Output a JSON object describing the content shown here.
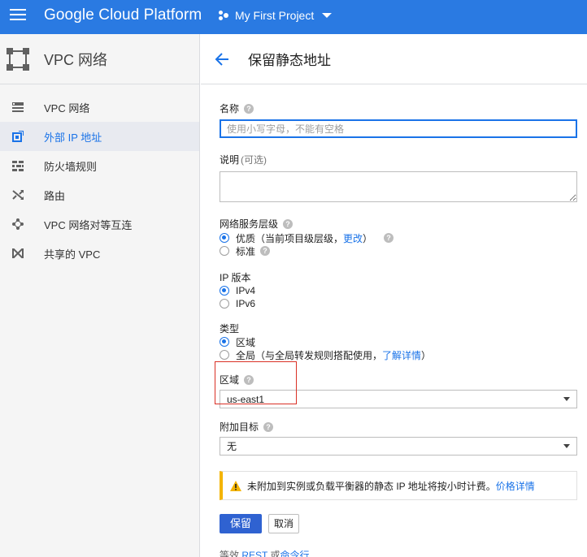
{
  "topbar": {
    "brand": "Google Cloud Platform",
    "project": "My First Project",
    "color": "#2a7ae2"
  },
  "sidebar": {
    "title": "VPC 网络",
    "items": [
      {
        "label": "VPC 网络",
        "icon": "vpc-network-icon",
        "active": false
      },
      {
        "label": "外部 IP 地址",
        "icon": "external-ip-icon",
        "active": true
      },
      {
        "label": "防火墙规则",
        "icon": "firewall-icon",
        "active": false
      },
      {
        "label": "路由",
        "icon": "routes-icon",
        "active": false
      },
      {
        "label": "VPC 网络对等互连",
        "icon": "peering-icon",
        "active": false
      },
      {
        "label": "共享的 VPC",
        "icon": "shared-vpc-icon",
        "active": false
      }
    ]
  },
  "main": {
    "title": "保留静态地址",
    "name_label": "名称",
    "name_placeholder": "使用小写字母，不能有空格",
    "desc_label": "说明",
    "desc_optional": "(可选)",
    "tier_label": "网络服务层级",
    "tier_options": [
      {
        "prefix": "优质（当前项目级层级，",
        "link": "更改",
        "suffix": "）",
        "selected": true
      },
      {
        "label": "标准",
        "selected": false
      }
    ],
    "ip_label": "IP 版本",
    "ip_options": [
      {
        "label": "IPv4",
        "selected": true
      },
      {
        "label": "IPv6",
        "selected": false
      }
    ],
    "type_label": "类型",
    "type_options": [
      {
        "label": "区域",
        "selected": true
      },
      {
        "prefix": "全局（与全局转发规则搭配使用，",
        "link": "了解详情",
        "suffix": "）",
        "selected": false
      }
    ],
    "region_label": "区域",
    "region_value": "us-east1",
    "attach_label": "附加目标",
    "attach_value": "无",
    "warning_text": "未附加到实例或负载平衡器的静态 IP 地址将按小时计费。",
    "warning_link": "价格详情",
    "save_label": "保留",
    "cancel_label": "取消",
    "equiv_prefix": "等效",
    "equiv_rest": "REST",
    "equiv_or": "或",
    "equiv_cli": "命令行"
  }
}
